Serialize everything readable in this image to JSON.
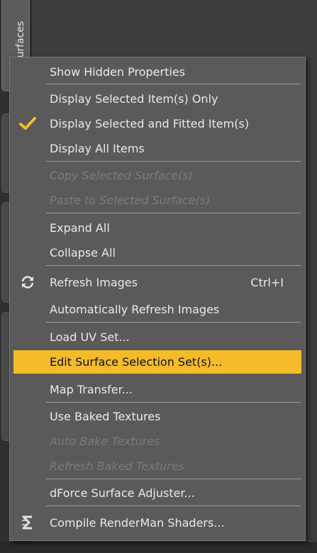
{
  "background": {
    "side_tab_label": "Surfaces"
  },
  "menu": {
    "items": [
      {
        "label": "Show Hidden Properties",
        "enabled": true
      },
      {
        "label": "Display Selected Item(s) Only",
        "enabled": true
      },
      {
        "label": "Display Selected and Fitted Item(s)",
        "enabled": true,
        "checked": true,
        "icon": "checkmark-icon"
      },
      {
        "label": "Display All Items",
        "enabled": true
      },
      {
        "label": "Copy Selected Surface(s)",
        "enabled": false
      },
      {
        "label": "Paste to Selected Surface(s)",
        "enabled": false
      },
      {
        "label": "Expand All",
        "enabled": true
      },
      {
        "label": "Collapse All",
        "enabled": true
      },
      {
        "label": "Refresh Images",
        "enabled": true,
        "shortcut": "Ctrl+I",
        "icon": "refresh-icon"
      },
      {
        "label": "Automatically Refresh Images",
        "enabled": true
      },
      {
        "label": "Load UV Set...",
        "enabled": true
      },
      {
        "label": "Edit Surface Selection Set(s)...",
        "enabled": true,
        "highlighted": true
      },
      {
        "label": "Map Transfer...",
        "enabled": true
      },
      {
        "label": "Use Baked Textures",
        "enabled": true
      },
      {
        "label": "Auto Bake Textures",
        "enabled": false
      },
      {
        "label": "Refresh Baked Textures",
        "enabled": false
      },
      {
        "label": "dForce Surface Adjuster...",
        "enabled": true
      },
      {
        "label": "Compile RenderMan Shaders...",
        "enabled": true,
        "icon": "shader-icon"
      }
    ]
  },
  "colors": {
    "menu_bg": "#5a5a5a",
    "highlight": "#f4bc29",
    "check": "#f4bc29",
    "disabled_text": "#7a7a7a"
  }
}
